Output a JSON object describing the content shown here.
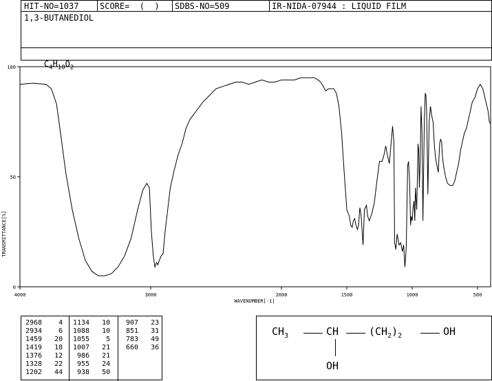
{
  "header": {
    "hit": "HIT-NO=1037",
    "score": "SCORE=  (  )",
    "sdbs": "SDBS-NO=509",
    "ir": "IR-NIDA-07944 : LIQUID FILM"
  },
  "compound": {
    "name": "1,3-BUTANEDIOL",
    "formula": {
      "c": "C",
      "c_n": "4",
      "h": "H",
      "h_n": "10",
      "o": "O",
      "o_n": "2"
    }
  },
  "chart_data": {
    "type": "line",
    "title": "",
    "xlabel": "WAVENUMBER[-1]",
    "ylabel": "TRANSMITTANCE[%]",
    "xlim": [
      4000,
      400
    ],
    "ylim": [
      0,
      100
    ],
    "x_inverted": true,
    "xticks": [
      4000,
      3000,
      2000,
      1500,
      1000,
      500
    ],
    "yticks": [
      0,
      50,
      100
    ],
    "grid": false,
    "series": [
      {
        "x": [
          4000,
          3900,
          3800,
          3760,
          3720,
          3690,
          3650,
          3600,
          3550,
          3500,
          3450,
          3400,
          3350,
          3300,
          3250,
          3200,
          3150,
          3100,
          3060,
          3030,
          3010,
          2995,
          2980,
          2968,
          2955,
          2945,
          2934,
          2920,
          2905,
          2890,
          2870,
          2850,
          2820,
          2790,
          2760,
          2730,
          2700,
          2650,
          2600,
          2550,
          2500,
          2450,
          2400,
          2350,
          2300,
          2250,
          2200,
          2150,
          2100,
          2050,
          2000,
          1950,
          1900,
          1850,
          1800,
          1750,
          1720,
          1700,
          1680,
          1660,
          1640,
          1600,
          1580,
          1560,
          1540,
          1520,
          1500,
          1480,
          1470,
          1459,
          1450,
          1440,
          1430,
          1419,
          1410,
          1400,
          1390,
          1376,
          1365,
          1350,
          1340,
          1328,
          1310,
          1290,
          1270,
          1250,
          1230,
          1215,
          1202,
          1190,
          1175,
          1160,
          1150,
          1140,
          1134,
          1125,
          1115,
          1100,
          1088,
          1075,
          1065,
          1055,
          1045,
          1035,
          1028,
          1020,
          1012,
          1007,
          1000,
          995,
          986,
          980,
          975,
          970,
          965,
          960,
          955,
          950,
          945,
          938,
          932,
          925,
          918,
          912,
          907,
          900,
          895,
          890,
          885,
          880,
          870,
          860,
          851,
          845,
          840,
          830,
          820,
          810,
          800,
          790,
          783,
          775,
          770,
          760,
          745,
          730,
          710,
          690,
          675,
          660,
          645,
          630,
          615,
          600,
          585,
          570,
          555,
          540,
          520,
          500,
          480,
          460,
          440,
          420,
          410,
          400
        ],
        "y": [
          92,
          92.5,
          92,
          90,
          83,
          70,
          52,
          35,
          22,
          12,
          7,
          5,
          5,
          6,
          9,
          14,
          22,
          35,
          44,
          47,
          45,
          25,
          14,
          9,
          11,
          10,
          12,
          14,
          15,
          25,
          35,
          45,
          53,
          60,
          65,
          72,
          76,
          80,
          84,
          87,
          90,
          91,
          92,
          93,
          93,
          92,
          93,
          94,
          93,
          93,
          94,
          94,
          94,
          95,
          95,
          95,
          94,
          93,
          91,
          89,
          90,
          90,
          88,
          82,
          70,
          52,
          35,
          32,
          28,
          27,
          30,
          31,
          28,
          26,
          28,
          36,
          32,
          19,
          35,
          37,
          32,
          30,
          33,
          38,
          48,
          57,
          57,
          60,
          64,
          60,
          56,
          66,
          73,
          66,
          20,
          17,
          24,
          19,
          20,
          16,
          19,
          9,
          18,
          55,
          57,
          48,
          28,
          32,
          30,
          35,
          39,
          30,
          45,
          40,
          35,
          50,
          65,
          62,
          45,
          60,
          82,
          70,
          30,
          55,
          76,
          88,
          87,
          80,
          62,
          42,
          75,
          82,
          78,
          76,
          75,
          64,
          58,
          55,
          52,
          65,
          67,
          66,
          60,
          55,
          50,
          47,
          46,
          46,
          48,
          52,
          56,
          62,
          66,
          70,
          72,
          76,
          80,
          84,
          86,
          90,
          92,
          90,
          85,
          80,
          75,
          74
        ]
      }
    ],
    "peaks": [
      [
        2968,
        4
      ],
      [
        2934,
        6
      ],
      [
        1459,
        20
      ],
      [
        1419,
        18
      ],
      [
        1376,
        12
      ],
      [
        1328,
        22
      ],
      [
        1202,
        44
      ],
      [
        1134,
        10
      ],
      [
        1088,
        10
      ],
      [
        1055,
        5
      ],
      [
        1007,
        21
      ],
      [
        986,
        21
      ],
      [
        955,
        24
      ],
      [
        938,
        50
      ],
      [
        907,
        23
      ],
      [
        851,
        31
      ],
      [
        783,
        49
      ],
      [
        660,
        36
      ]
    ]
  },
  "structure": {
    "ch3": "CH",
    "ch3_sub": "3",
    "ch": "CH",
    "ch2": "(CH",
    "ch2_sub": "2",
    "ch2_close": ")",
    "ch2_n": "2",
    "oh_end": "OH",
    "oh_bottom": "OH"
  }
}
